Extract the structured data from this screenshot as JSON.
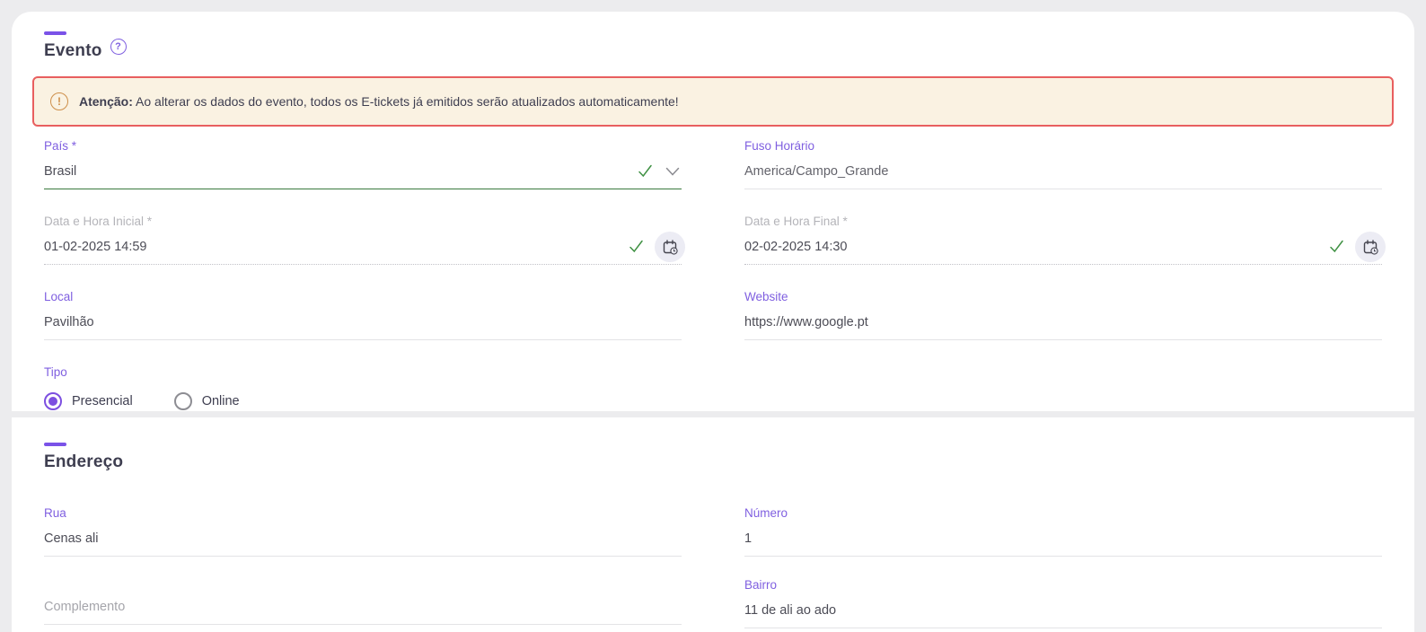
{
  "colors": {
    "accent": "#7f5fe0",
    "alert_border": "#e85f5f",
    "alert_bg": "#faf2e2",
    "success": "#3f9143"
  },
  "evento": {
    "title": "Evento",
    "help_icon": "?",
    "alert": {
      "icon": "!",
      "bold": "Atenção:",
      "text": " Ao alterar os dados do evento, todos os E-tickets já emitidos serão atualizados automaticamente!"
    },
    "fields": {
      "pais": {
        "label": "País *",
        "value": "Brasil"
      },
      "fuso": {
        "label": "Fuso Horário",
        "value": "America/Campo_Grande"
      },
      "data_inicial": {
        "label": "Data e Hora Inicial *",
        "value": "01-02-2025 14:59"
      },
      "data_final": {
        "label": "Data e Hora Final *",
        "value": "02-02-2025 14:30"
      },
      "local": {
        "label": "Local",
        "value": "Pavilhão"
      },
      "website": {
        "label": "Website",
        "value": "https://www.google.pt"
      },
      "tipo": {
        "label": "Tipo",
        "options": [
          {
            "label": "Presencial",
            "selected": true
          },
          {
            "label": "Online",
            "selected": false
          }
        ]
      }
    }
  },
  "endereco": {
    "title": "Endereço",
    "fields": {
      "rua": {
        "label": "Rua",
        "value": "Cenas ali"
      },
      "numero": {
        "label": "Número",
        "value": "1"
      },
      "complemento": {
        "placeholder": "Complemento",
        "value": ""
      },
      "bairro": {
        "label": "Bairro",
        "value": "11 de ali ao ado"
      }
    }
  }
}
